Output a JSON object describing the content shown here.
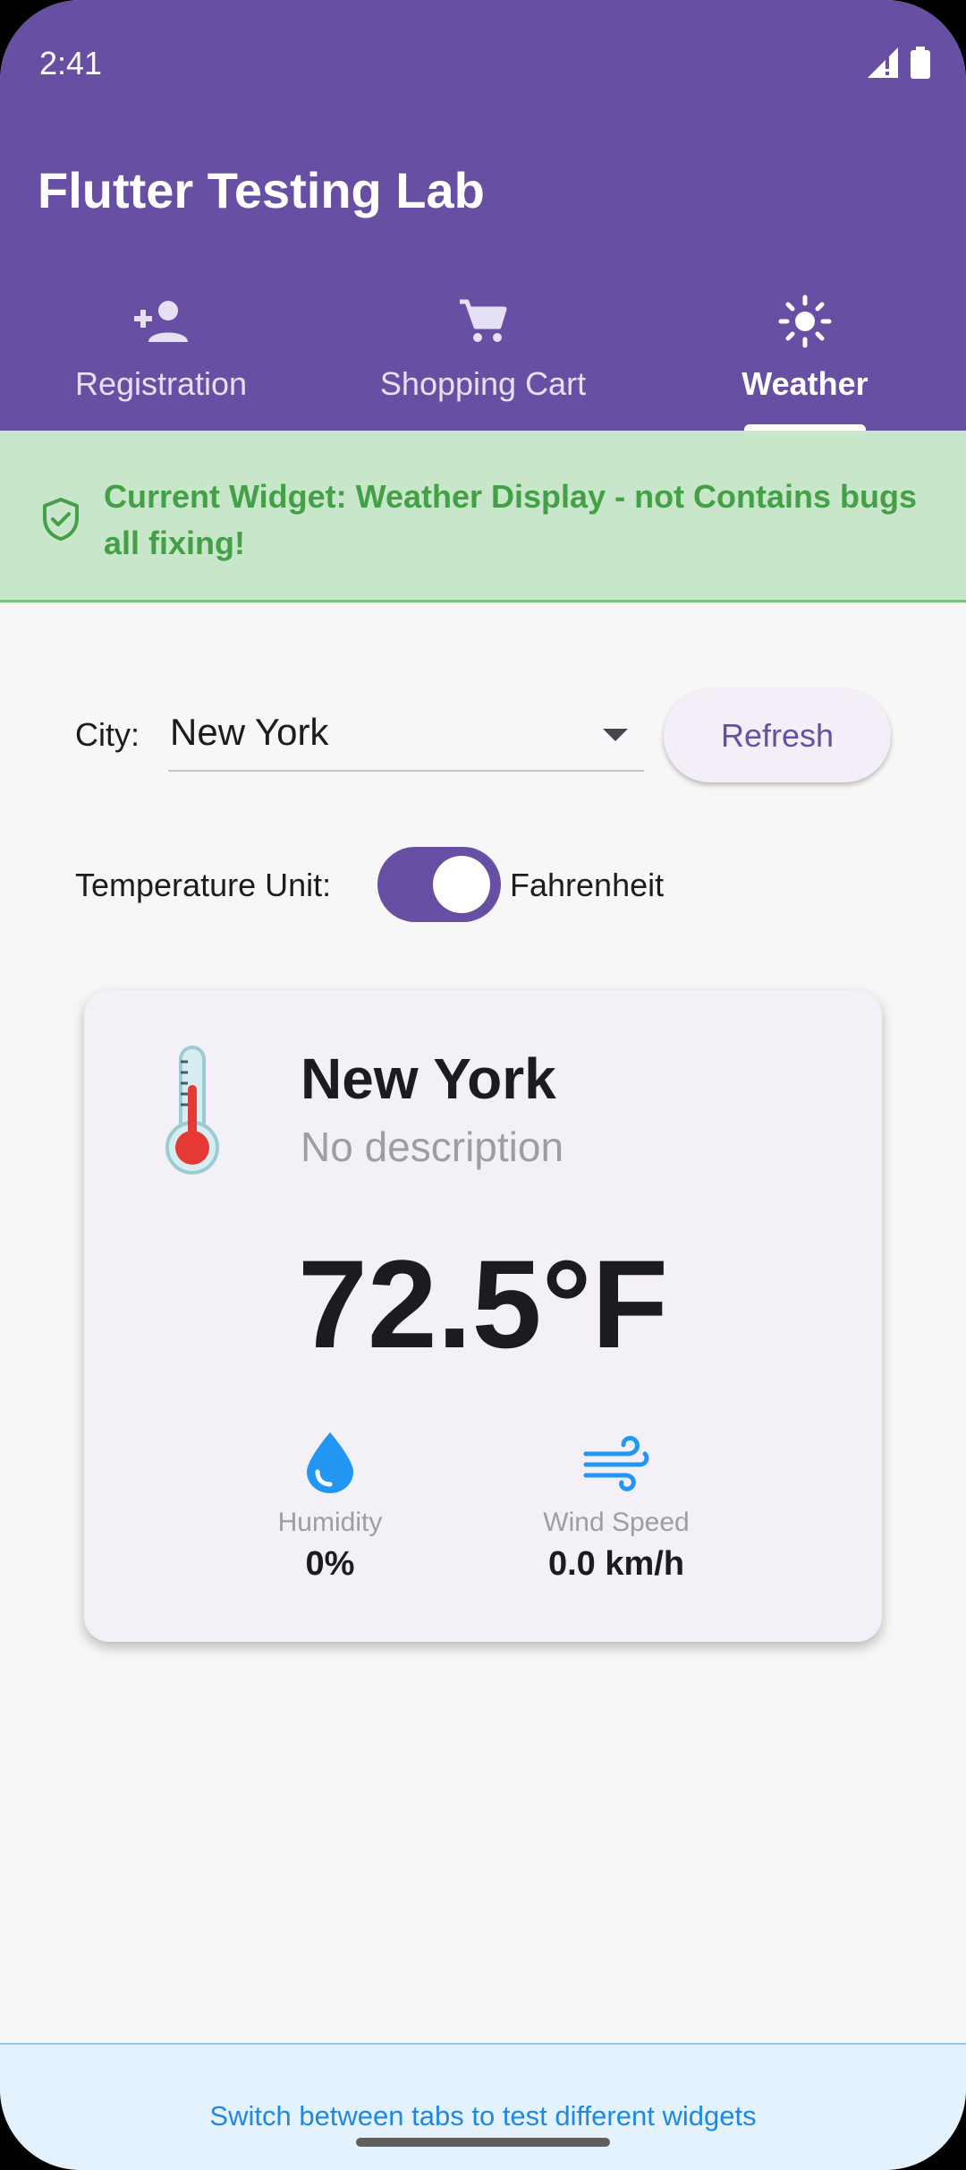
{
  "status_bar": {
    "time": "2:41"
  },
  "app": {
    "title": "Flutter Testing Lab"
  },
  "tabs": [
    {
      "label": "Registration",
      "icon": "person-add-icon",
      "active": false
    },
    {
      "label": "Shopping Cart",
      "icon": "shopping-cart-icon",
      "active": false
    },
    {
      "label": "Weather",
      "icon": "sun-icon",
      "active": true
    }
  ],
  "banner": {
    "icon": "shield-check-icon",
    "text": "Current Widget: Weather Display - not Contains bugs all fixing!"
  },
  "controls": {
    "city_label": "City:",
    "city_value": "New York",
    "refresh_label": "Refresh",
    "unit_label": "Temperature Unit:",
    "unit_value": "Fahrenheit",
    "unit_switch_on": true
  },
  "weather_card": {
    "icon": "thermometer-icon",
    "city": "New York",
    "description": "No description",
    "temperature": "72.5°F",
    "humidity_label": "Humidity",
    "humidity_value": "0%",
    "wind_label": "Wind Speed",
    "wind_value": "0.0 km/h"
  },
  "footer": {
    "text": "Switch between tabs to test different widgets"
  },
  "colors": {
    "primary": "#6750A4",
    "banner_bg": "#C8E6C9",
    "banner_text": "#43A047",
    "footer_bg": "#E3F2FD",
    "footer_text": "#1E88E5",
    "stat_icon": "#2196F3"
  }
}
